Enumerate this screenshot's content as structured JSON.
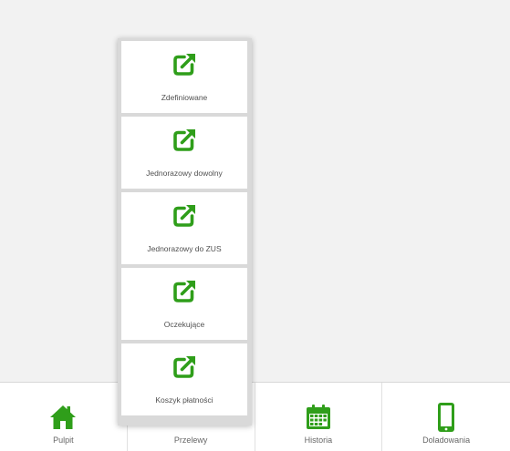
{
  "colors": {
    "accent": "#2f9e1a",
    "background": "#f2f2f2"
  },
  "submenu": {
    "items": [
      {
        "label": "Zdefiniowane",
        "icon": "external-link-icon"
      },
      {
        "label": "Jednorazowy dowolny",
        "icon": "external-link-icon"
      },
      {
        "label": "Jednorazowy do ZUS",
        "icon": "external-link-icon"
      },
      {
        "label": "Oczekujące",
        "icon": "external-link-icon"
      },
      {
        "label": "Koszyk płatności",
        "icon": "external-link-icon"
      }
    ]
  },
  "bottom_nav": {
    "items": [
      {
        "label": "Pulpit",
        "icon": "home-icon"
      },
      {
        "label": "Przelewy",
        "icon": "external-link-icon"
      },
      {
        "label": "Historia",
        "icon": "calendar-icon"
      },
      {
        "label": "Doladowania",
        "icon": "smartphone-icon"
      }
    ]
  }
}
